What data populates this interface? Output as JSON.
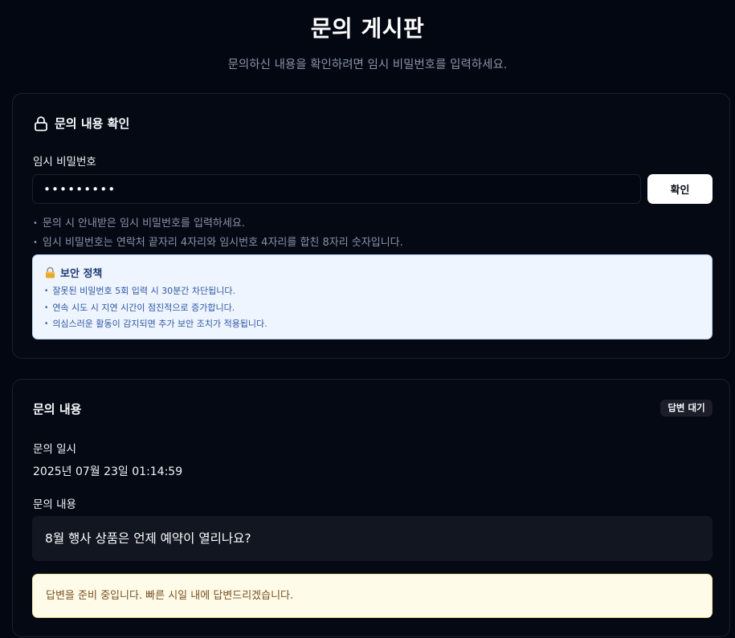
{
  "header": {
    "title": "문의 게시판",
    "subtitle": "문의하신 내용을 확인하려면 임시 비밀번호를 입력하세요."
  },
  "verify": {
    "title": "문의 내용 확인",
    "password_label": "임시 비밀번호",
    "password_value": "123456789",
    "confirm_label": "확인",
    "hints": [
      "문의 시 안내받은 임시 비밀번호를 입력하세요.",
      "임시 비밀번호는 연락처 끝자리 4자리와 임시번호 4자리를 합친 8자리 숫자입니다."
    ],
    "policy": {
      "title": "보안 정책",
      "items": [
        "잘못된 비밀번호 5회 입력 시 30분간 차단됩니다.",
        "연속 시도 시 지연 시간이 점진적으로 증가합니다.",
        "의심스러운 활동이 감지되면 추가 보안 조치가 적용됩니다."
      ]
    }
  },
  "inquiry": {
    "title": "문의 내용",
    "status": "답변 대기",
    "date_label": "문의 일시",
    "date_value": "2025년 07월 23일 01:14:59",
    "content_label": "문의 내용",
    "content": "8월 행사 상품은 언제 예약이 열리나요?",
    "notice": "답변을 준비 중입니다. 빠른 시일 내에 답변드리겠습니다."
  },
  "icons": {
    "verify_header": "lock-icon",
    "policy_header": "padlock-icon"
  },
  "colors": {
    "background": "#030712",
    "policy_bg": "#eef5ff",
    "policy_text": "#2c56a8",
    "notice_bg": "#fefce8",
    "notice_text": "#7b4e1d"
  }
}
